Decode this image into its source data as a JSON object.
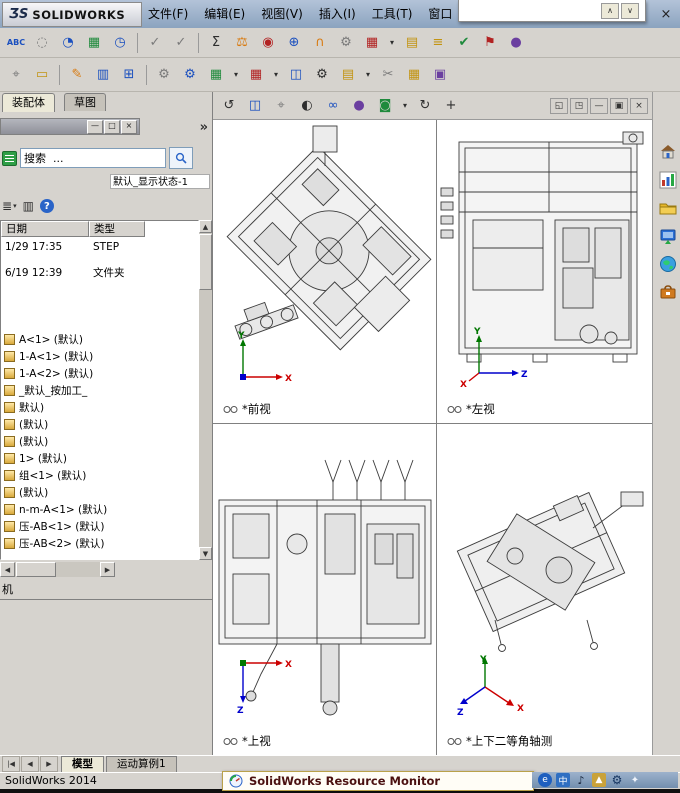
{
  "colors": {
    "axis_x": "#cc0000",
    "axis_y": "#007700",
    "axis_z": "#0000cc",
    "accent_blue": "#2a64c8"
  },
  "titlebar": {
    "logo_mark": "ƷS",
    "logo_text": "SOLIDWORKS",
    "menus": [
      "文件(F)",
      "编辑(E)",
      "视图(V)",
      "插入(I)",
      "工具(T)",
      "窗口"
    ],
    "overlay_buttons": {
      "up": "∧",
      "down": "∨"
    },
    "close_glyph": "×"
  },
  "toolbar1": {
    "icons": [
      {
        "name": "spell-check",
        "glyph": "ABC"
      },
      {
        "name": "circle-tool",
        "glyph": "◌"
      },
      {
        "name": "update-arc",
        "glyph": "◔"
      },
      {
        "name": "hole-grid",
        "glyph": "▦"
      },
      {
        "name": "measure-clock",
        "glyph": "◷"
      },
      {
        "name": "verify-check-a",
        "glyph": "✓"
      },
      {
        "name": "verify-check-b",
        "glyph": "✓"
      },
      {
        "name": "equations",
        "glyph": "Σ"
      },
      {
        "name": "mass-properties",
        "glyph": "⚖"
      },
      {
        "name": "sensor-dot",
        "glyph": "◉"
      },
      {
        "name": "interference-detection",
        "glyph": "⊕"
      },
      {
        "name": "mate-arc",
        "glyph": "∩"
      },
      {
        "name": "options-gear",
        "glyph": "⚙"
      },
      {
        "name": "design-table",
        "glyph": "▦"
      },
      {
        "name": "design-table-caret",
        "glyph": "▾"
      },
      {
        "name": "bom-grid",
        "glyph": "▤"
      },
      {
        "name": "layer-stack",
        "glyph": "≡"
      },
      {
        "name": "check-circle",
        "glyph": "✔"
      },
      {
        "name": "flag",
        "glyph": "⚑"
      },
      {
        "name": "appearance-sphere",
        "glyph": "●"
      }
    ]
  },
  "toolbar2": {
    "icons": [
      {
        "name": "pin-target",
        "glyph": "⌖"
      },
      {
        "name": "doc-strip",
        "glyph": "▭"
      },
      {
        "name": "sketch-pencil",
        "glyph": "✎"
      },
      {
        "name": "column-grid",
        "glyph": "▥"
      },
      {
        "name": "zoom-window",
        "glyph": "⊞"
      },
      {
        "name": "gear-pair",
        "glyph": "⚙"
      },
      {
        "name": "gear-blue",
        "glyph": "⚙"
      },
      {
        "name": "pattern-grid",
        "glyph": "▦"
      },
      {
        "name": "pattern-caret",
        "glyph": "▾"
      },
      {
        "name": "table-red",
        "glyph": "▦"
      },
      {
        "name": "table-caret",
        "glyph": "▾"
      },
      {
        "name": "window-pane",
        "glyph": "◫"
      },
      {
        "name": "small-gear",
        "glyph": "⚙"
      },
      {
        "name": "gold-grid",
        "glyph": "▤"
      },
      {
        "name": "gold-caret",
        "glyph": "▾"
      },
      {
        "name": "trim-scissors",
        "glyph": "✂"
      },
      {
        "name": "amber-grid",
        "glyph": "▦"
      },
      {
        "name": "image-box",
        "glyph": "▣"
      }
    ]
  },
  "vp_toolbar": {
    "icons": [
      {
        "name": "previous-view",
        "glyph": "↺"
      },
      {
        "name": "pane-split",
        "glyph": "◫"
      },
      {
        "name": "view-target",
        "glyph": "⌖"
      },
      {
        "name": "display-style",
        "glyph": "◐"
      },
      {
        "name": "hide-show-items",
        "glyph": "∞"
      },
      {
        "name": "edit-appearance",
        "glyph": "●"
      },
      {
        "name": "apply-scene",
        "glyph": "◙"
      },
      {
        "name": "view-settings-caret",
        "glyph": "▾"
      },
      {
        "name": "rotate-view",
        "glyph": "↻"
      },
      {
        "name": "pan-view",
        "glyph": "+"
      }
    ],
    "window_controls": [
      {
        "name": "tile-windows",
        "glyph": "◱"
      },
      {
        "name": "cascade-windows",
        "glyph": "◳"
      },
      {
        "name": "minimize-window",
        "glyph": "—"
      },
      {
        "name": "restore-window",
        "glyph": "▣"
      },
      {
        "name": "close-viewport",
        "glyph": "×"
      }
    ]
  },
  "left_panel": {
    "tabs": [
      "装配体",
      "草图"
    ],
    "window_buttons": [
      "—",
      "□",
      "×"
    ],
    "chevrons": "»",
    "search_text": "搜索  ...",
    "display_state": "默认_显示状态-1",
    "view_icons": [
      {
        "name": "list-view",
        "glyph": "≣"
      },
      {
        "name": "list-caret",
        "glyph": "▾"
      },
      {
        "name": "column-options",
        "glyph": "▥"
      },
      {
        "name": "help",
        "glyph": "?"
      }
    ],
    "columns": [
      "日期",
      "类型"
    ],
    "files": [
      {
        "date": "1/29 17:35",
        "type": "STEP"
      },
      {
        "date": "6/19 12:39",
        "type": "文件夹"
      }
    ],
    "tree": [
      "A<1> (默认)",
      "1-A<1> (默认)",
      "1-A<2> (默认)",
      "_默认_按加工_",
      "默认)",
      "(默认)",
      "(默认)",
      "1> (默认)",
      "组<1> (默认)",
      "(默认)",
      "n-m-A<1> (默认)",
      "压-AB<1> (默认)",
      "压-AB<2> (默认)"
    ],
    "bottom_label": "机",
    "scroll_arrows": {
      "up": "▲",
      "down": "▼",
      "left": "◀",
      "right": "▶"
    }
  },
  "right_toolbar": {
    "icons": [
      "home",
      "resources",
      "folder",
      "display",
      "appearance",
      "library"
    ]
  },
  "viewports": [
    {
      "label": "*前视",
      "axes": [
        "Y",
        "X"
      ]
    },
    {
      "label": "*左视",
      "axes": [
        "Y",
        "X",
        "Z"
      ]
    },
    {
      "label": "*上视",
      "axes": [
        "X",
        "Z"
      ]
    },
    {
      "label": "*上下二等角轴测",
      "axes": [
        "Y",
        "X",
        "Z"
      ]
    }
  ],
  "bottom": {
    "nav": [
      "|◀",
      "◀",
      "▶"
    ],
    "tabs": [
      "模型",
      "运动算例1"
    ],
    "status": "SolidWorks 2014",
    "resource_monitor": "SolidWorks Resource Monitor"
  },
  "tray": {
    "icons": [
      {
        "name": "browser",
        "glyph": "e"
      },
      {
        "name": "ime-chinese",
        "glyph": "中"
      },
      {
        "name": "volume",
        "glyph": "♪"
      },
      {
        "name": "shield",
        "glyph": "▲"
      },
      {
        "name": "gear",
        "glyph": "⚙"
      },
      {
        "name": "device",
        "glyph": "✦"
      }
    ]
  }
}
